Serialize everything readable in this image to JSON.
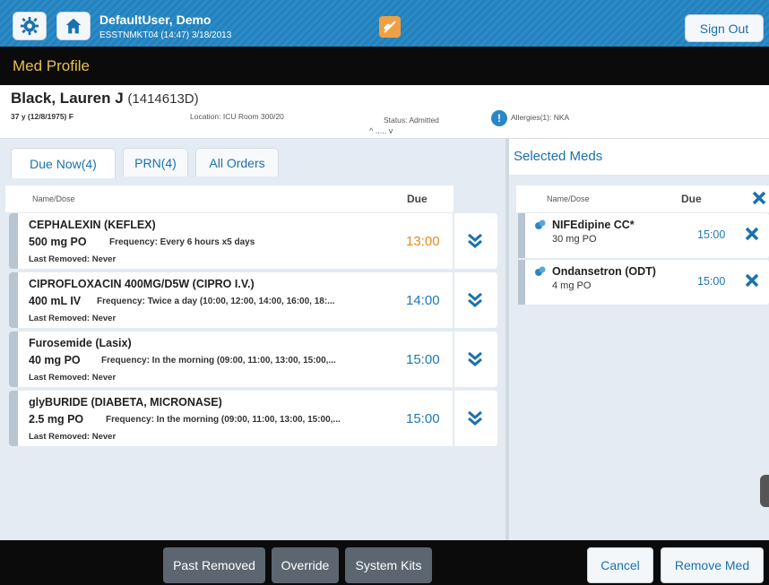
{
  "header": {
    "user_name": "DefaultUser, Demo",
    "user_sub": "ESSTNMKT04 (14:47) 3/18/2013",
    "signout_label": "Sign Out"
  },
  "page": {
    "title": "Med Profile"
  },
  "patient": {
    "name": "Black, Lauren J",
    "id": "(1414613D)",
    "dob": "37 y (12/8/1975) F",
    "location": "Location: ICU Room 300/20",
    "status": "Status: Admitted",
    "more": "^ ..... v",
    "allergy_icon": "!",
    "allergies": "Allergies(1): NKA"
  },
  "tabs": [
    {
      "label": "Due Now(4)",
      "active": true
    },
    {
      "label": "PRN(4)",
      "active": false
    },
    {
      "label": "All Orders",
      "active": false
    }
  ],
  "list": {
    "col_name": "Name/Dose",
    "col_due": "Due",
    "meds": [
      {
        "name": "CEPHALEXIN (KEFLEX)",
        "dose": "500 mg PO",
        "frequency": "Frequency: Every 6 hours x5 days",
        "last_removed": "Last Removed: Never",
        "due": "13:00",
        "overdue": true
      },
      {
        "name": "CIPROFLOXACIN 400MG/D5W (CIPRO I.V.)",
        "dose": "400 mL IV",
        "frequency": "Frequency: Twice a day (10:00, 12:00, 14:00, 16:00, 18:...",
        "last_removed": "Last Removed: Never",
        "due": "14:00",
        "overdue": false
      },
      {
        "name": "Furosemide (Lasix)",
        "dose": "40 mg PO",
        "frequency": "Frequency: In the morning (09:00, 11:00, 13:00, 15:00,...",
        "last_removed": "Last Removed: Never",
        "due": "15:00",
        "overdue": false
      },
      {
        "name": "glyBURIDE (DIABETA, MICRONASE)",
        "dose": "2.5 mg PO",
        "frequency": "Frequency: In the morning (09:00, 11:00, 13:00, 15:00,...",
        "last_removed": "Last Removed: Never",
        "due": "15:00",
        "overdue": false
      }
    ]
  },
  "selected": {
    "title": "Selected Meds",
    "col_name": "Name/Dose",
    "col_due": "Due",
    "meds": [
      {
        "name": "NIFEdipine CC*",
        "dose": "30 mg PO",
        "due": "15:00"
      },
      {
        "name": "Ondansetron (ODT)",
        "dose": "4 mg PO",
        "due": "15:00"
      }
    ]
  },
  "footer": {
    "past_removed": "Past Removed",
    "override": "Override",
    "system_kits": "System Kits",
    "cancel": "Cancel",
    "remove_med": "Remove Med"
  },
  "colors": {
    "accent": "#1a72ad",
    "header_blue": "#2a8cc8",
    "title_gold": "#e8c04a",
    "overdue_orange": "#e58a1f"
  },
  "icons": {
    "settings": "gear-icon",
    "home": "home-icon",
    "center": "pill-override-icon",
    "expand": "double-chevron-down-icon",
    "remove": "close-icon",
    "med_type": "pill-icon"
  }
}
